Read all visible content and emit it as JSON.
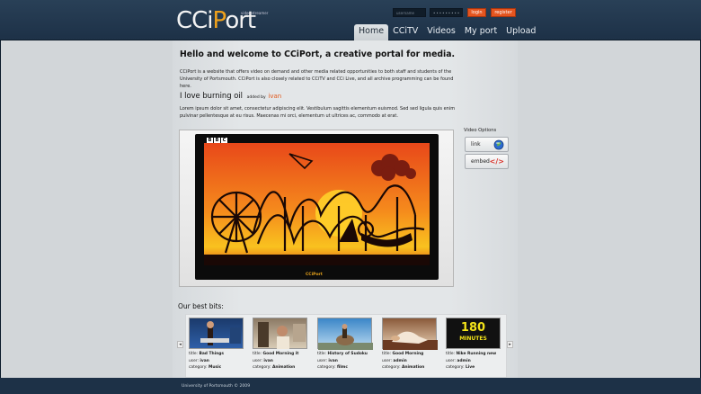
{
  "header": {
    "logo_text_1": "CCi",
    "logo_text_o": "P",
    "logo_text_2": "ort",
    "logo_tagline": "video streamer",
    "username_placeholder": "username",
    "password_value": "•••••••••",
    "login_label": "login",
    "register_label": "register"
  },
  "nav": [
    "Home",
    "CCiTV",
    "Videos",
    "My port",
    "Upload"
  ],
  "main": {
    "welcome_title": "Hello and welcome to CCiPort, a creative portal for media.",
    "intro": "CCiPort is a website that offers video on demand and other media related opportunities to both staff and students of the University of Portsmouth. CCiPort is also closely related to CCiTV and CCi Live, and all archive programming can be found here.",
    "video_title": "I love burning oil",
    "added_by_label": "added by",
    "added_by_user": "ivan",
    "description": "Lorem ipsum dolor sit amet, consectetur adipiscing elit. Vestibulum sagittis elementum euismod. Sed sed ligula quis enim pulvinar pellentesque at eu risus. Maecenas mi orci, elementum ut ultrices ac, commodo at erat.",
    "screen_logo": "CCiPort"
  },
  "player": {
    "channel_letters": [
      "B",
      "B",
      "C"
    ]
  },
  "video_options": {
    "label": "Video Options",
    "link_label": "link",
    "embed_label": "embed",
    "embed_icon_text": "</>"
  },
  "best_bits": {
    "title": "Our best bits:",
    "prev_arrow": "◂",
    "next_arrow": "▸",
    "items": [
      {
        "title_label": "title:",
        "title": "Bad Things",
        "user_label": "user:",
        "user": "ivan",
        "category_label": "category:",
        "category": "Music",
        "thumb_colors": [
          "#1b3a6b",
          "#2e5fa8"
        ]
      },
      {
        "title_label": "title:",
        "title": "Good Morning it",
        "user_label": "user:",
        "user": "ivan",
        "category_label": "category:",
        "category": "Animation",
        "thumb_colors": [
          "#8c7a65",
          "#d8cbb5"
        ]
      },
      {
        "title_label": "title:",
        "title": "History of Sudoku",
        "user_label": "user:",
        "user": "ivan",
        "category_label": "category:",
        "category": "filmc",
        "thumb_colors": [
          "#3a86c8",
          "#b9d9ef"
        ]
      },
      {
        "title_label": "title:",
        "title": "Good Morning",
        "user_label": "user:",
        "user": "admin",
        "category_label": "category:",
        "category": "Animation",
        "thumb_colors": [
          "#8a5a3a",
          "#e8d0b4"
        ]
      },
      {
        "title_label": "title:",
        "title": "Nike Running new",
        "user_label": "user:",
        "user": "admin",
        "category_label": "category:",
        "category": "Live",
        "thumb_colors": [
          "#111111",
          "#222222"
        ],
        "thumb_text_1": "180",
        "thumb_text_2": "MINUTES"
      }
    ]
  },
  "footer": {
    "text": "University of Portsmouth © 2009"
  },
  "colors": {
    "header_bg": "#233a50",
    "accent_orange": "#e5551f",
    "logo_orange": "#f0a21c",
    "page_bg": "#d2d6d9"
  }
}
